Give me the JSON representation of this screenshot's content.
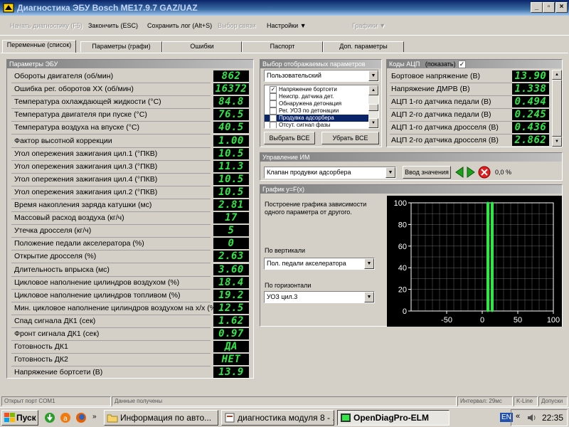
{
  "window": {
    "title": "Диагностика ЭБУ Bosch ME17.9.7 GAZ/UAZ"
  },
  "toolbar": {
    "items": [
      {
        "label": "Начать диагностику (F5)",
        "enabled": false
      },
      {
        "label": "Закончить (ESC)",
        "enabled": true
      },
      {
        "label": "Сохранить лог (Alt+S)",
        "enabled": true
      },
      {
        "label": "Выбор связи",
        "enabled": false
      },
      {
        "label": "Настройки",
        "enabled": true
      },
      {
        "label": "Графики",
        "enabled": false
      }
    ]
  },
  "tabs": [
    "Переменные (список)",
    "Параметры (графи)",
    "Ошибки",
    "Паспорт",
    "Доп. параметры"
  ],
  "ecu": {
    "title": "Параметры ЭБУ",
    "rows": [
      {
        "label": "Обороты двигателя (об/мин)",
        "value": "862"
      },
      {
        "label": "Ошибка рег. оборотов ХХ (об/мин)",
        "value": "16372"
      },
      {
        "label": "Температура охлаждающей жидкости (°С)",
        "value": "84.8"
      },
      {
        "label": "Температура двигателя при пуске (°С)",
        "value": "76.5"
      },
      {
        "label": "Температура воздуха на впуске (°С)",
        "value": "40.5"
      },
      {
        "label": "Фактор высотной коррекции",
        "value": "1.00"
      },
      {
        "label": "Угол опережения зажигания цил.1 (°ПКВ)",
        "value": "10.5"
      },
      {
        "label": "Угол опережения зажигания цил.3 (°ПКВ)",
        "value": "11.3"
      },
      {
        "label": "Угол опережения зажигания цил.4 (°ПКВ)",
        "value": "10.5"
      },
      {
        "label": "Угол опережения зажигания цил.2 (°ПКВ)",
        "value": "10.5"
      },
      {
        "label": "Время накопления заряда катушки (мс)",
        "value": "2.81"
      },
      {
        "label": "Массовый расход воздуха (кг/ч)",
        "value": "17"
      },
      {
        "label": "Утечка дросселя (кг/ч)",
        "value": "5"
      },
      {
        "label": "Положение педали акселератора (%)",
        "value": "0"
      },
      {
        "label": "Открытие дросселя (%)",
        "value": "2.63"
      },
      {
        "label": "Длительность впрыска (мс)",
        "value": "3.60"
      },
      {
        "label": "Цикловое наполнение цилиндров воздухом (%)",
        "value": "18.4"
      },
      {
        "label": "Цикловое наполнение цилиндров топливом (%)",
        "value": "19.2"
      },
      {
        "label": "Мин. цикловое наполнение цилиндров воздухом на х/х (%)",
        "value": "12.5"
      },
      {
        "label": "Спад сигнала ДК1 (сек)",
        "value": "1.62"
      },
      {
        "label": "Фронт сигнала ДК1 (сек)",
        "value": "0.97"
      },
      {
        "label": "Готовность ДК1",
        "value": "ДА"
      },
      {
        "label": "Готовность ДК2",
        "value": "НЕТ"
      },
      {
        "label": "Напряжение бортсети (В)",
        "value": "13.9"
      }
    ]
  },
  "select_params": {
    "title": "Выбор отображаемых параметров",
    "preset": "Пользовательский",
    "items": [
      {
        "label": "Напряжение бортсети",
        "checked": true,
        "selected": false
      },
      {
        "label": "Неиспр. датчика дет.",
        "checked": false,
        "selected": false
      },
      {
        "label": "Обнаружена детонация",
        "checked": false,
        "selected": false
      },
      {
        "label": "Рег. УОЗ по детонации",
        "checked": false,
        "selected": false
      },
      {
        "label": "Продувка адсорбера",
        "checked": false,
        "selected": true
      },
      {
        "label": "Отсут. сигнал фазы",
        "checked": false,
        "selected": false
      }
    ],
    "select_all": "Выбрать ВСЕ",
    "remove_all": "Убрать ВСЕ"
  },
  "adc": {
    "title": "Коды АЦП",
    "show_label": "(показать)",
    "show_checked": true,
    "rows": [
      {
        "label": "Бортовое напряжение (В)",
        "value": "13.90"
      },
      {
        "label": "Напряжение ДМРВ (В)",
        "value": "1.338"
      },
      {
        "label": "АЦП 1-го датчика педали (В)",
        "value": "0.494"
      },
      {
        "label": "АЦП 2-го датчика педали (В)",
        "value": "0.245"
      },
      {
        "label": "АЦП 1-го датчика дросселя (В)",
        "value": "0.436"
      },
      {
        "label": "АЦП 2-го датчика дросселя (В)",
        "value": "2.862"
      }
    ]
  },
  "im_control": {
    "title": "Управление ИМ",
    "device": "Клапан продувки адсорбера",
    "enter_value": "Ввод значения",
    "percent": "0,0 %"
  },
  "graph": {
    "title": "График y=F(x)",
    "description": "Построение графика зависимости одного параметра от другого.",
    "vertical_label": "По вертикали",
    "vertical_value": "Пол. педали акселератора",
    "horizontal_label": "По горизонтали",
    "horizontal_value": "УОЗ цил.3"
  },
  "chart_data": {
    "type": "scatter",
    "title": "",
    "xlabel": "",
    "ylabel": "",
    "xlim": [
      -100,
      100
    ],
    "ylim": [
      0,
      100
    ],
    "xticks": [
      -50,
      0,
      50,
      100
    ],
    "yticks": [
      0,
      20,
      40,
      60,
      80,
      100
    ],
    "grid": true,
    "series": [
      {
        "color": "#2ee845",
        "x": [
          8,
          8,
          8,
          8,
          8,
          8
        ],
        "y": [
          0,
          20,
          40,
          60,
          80,
          100
        ]
      },
      {
        "color": "#2ee845",
        "x": [
          14,
          14,
          14,
          14,
          14,
          14
        ],
        "y": [
          0,
          20,
          40,
          60,
          80,
          100
        ]
      }
    ]
  },
  "status": {
    "port": "Открыт порт COM1",
    "received": "Данные получены",
    "interval": "Интервал: 29мс",
    "line": "K-Line",
    "passes": "Допуски"
  },
  "taskbar": {
    "start": "Пуск",
    "tasks": [
      {
        "label": "Информация  по авто...",
        "active": false
      },
      {
        "label": "диагностика модуля 8 - ...",
        "active": false
      },
      {
        "label": "OpenDiagPro-ELM",
        "active": true
      }
    ],
    "lang": "EN",
    "time": "22:35"
  },
  "colors": {
    "lcd_bg": "#000000",
    "lcd_fg": "#2ee845",
    "title_bar": "#0a246a",
    "face": "#d4d0c8"
  }
}
